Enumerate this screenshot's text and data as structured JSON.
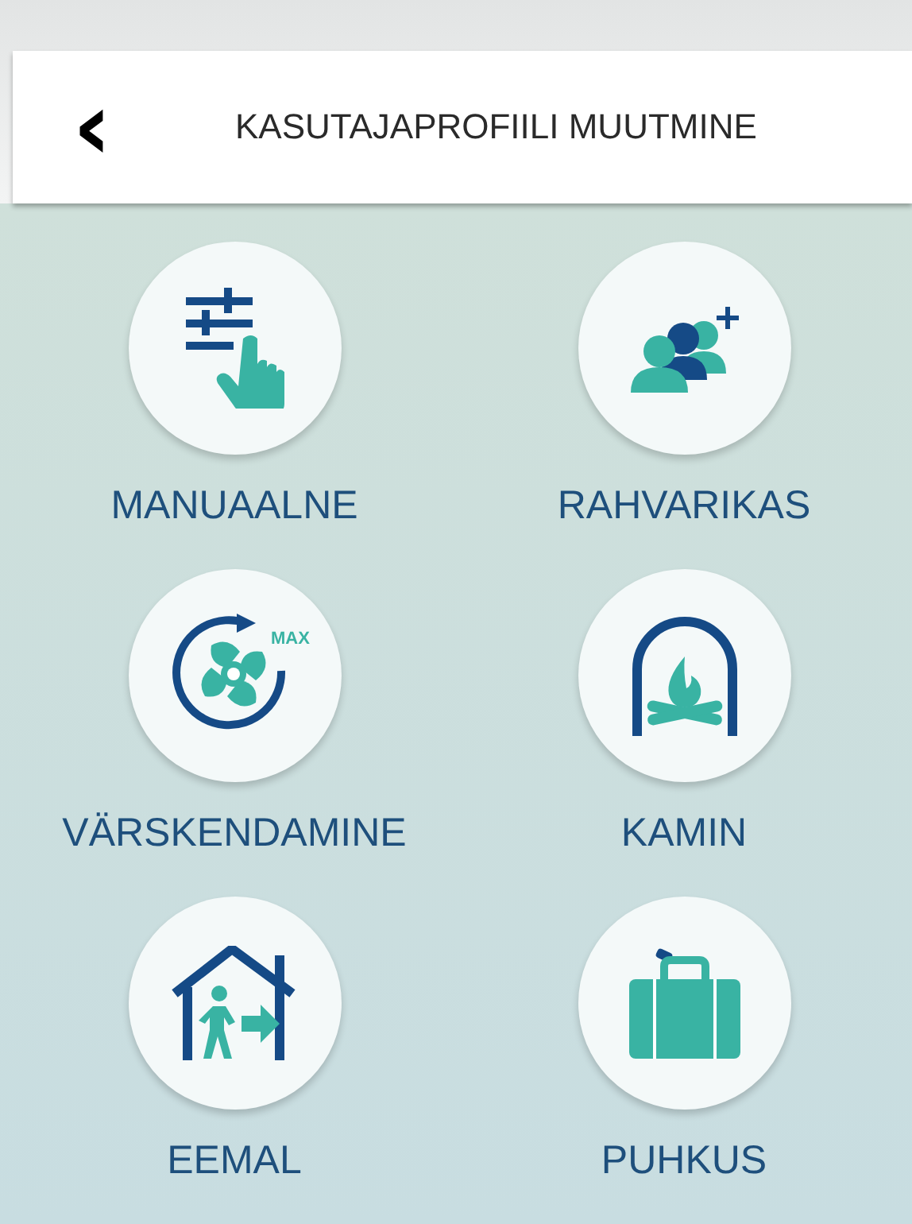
{
  "header": {
    "back": "‹",
    "title": "KASUTAJAPROFIILI MUUTMINE"
  },
  "profiles": [
    {
      "kind": "manual",
      "label": "MANUAALNE"
    },
    {
      "kind": "crowd",
      "label": "RAHVARIKAS"
    },
    {
      "kind": "boost",
      "label": "VÄRSKENDAMINE",
      "badge": "MAX"
    },
    {
      "kind": "fireplace",
      "label": "KAMIN"
    },
    {
      "kind": "away",
      "label": "EEMAL"
    },
    {
      "kind": "holiday",
      "label": "PUHKUS"
    }
  ]
}
